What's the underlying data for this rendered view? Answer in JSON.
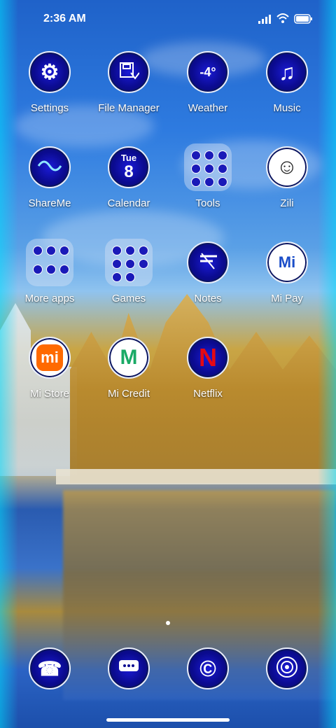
{
  "status_bar": {
    "time": "2:36 AM"
  },
  "apps": [
    {
      "label": "Settings",
      "icon": "gear-icon"
    },
    {
      "label": "File Manager",
      "icon": "folder-save-icon"
    },
    {
      "label": "Weather",
      "icon": "weather-icon",
      "text": "-4°"
    },
    {
      "label": "Music",
      "icon": "music-note-icon"
    },
    {
      "label": "ShareMe",
      "icon": "wave-icon"
    },
    {
      "label": "Calendar",
      "icon": "calendar-icon",
      "day": "Tue",
      "date": "8"
    },
    {
      "label": "Tools",
      "icon": "folder-icon"
    },
    {
      "label": "Zili",
      "icon": "smiley-icon"
    },
    {
      "label": "More apps",
      "icon": "folder-icon"
    },
    {
      "label": "Games",
      "icon": "folder-icon"
    },
    {
      "label": "Notes",
      "icon": "notes-icon"
    },
    {
      "label": "Mi Pay",
      "icon": "mi-pay-icon",
      "text": "Mi Pay"
    },
    {
      "label": "Mi Store",
      "icon": "mi-store-icon",
      "text": "mi"
    },
    {
      "label": "Mi Credit",
      "icon": "mi-credit-icon",
      "text": "M"
    },
    {
      "label": "Netflix",
      "icon": "netflix-icon",
      "text": "N"
    }
  ],
  "dock": [
    {
      "icon": "phone-icon"
    },
    {
      "icon": "messages-icon"
    },
    {
      "icon": "browser-icon"
    },
    {
      "icon": "camera-icon"
    }
  ]
}
